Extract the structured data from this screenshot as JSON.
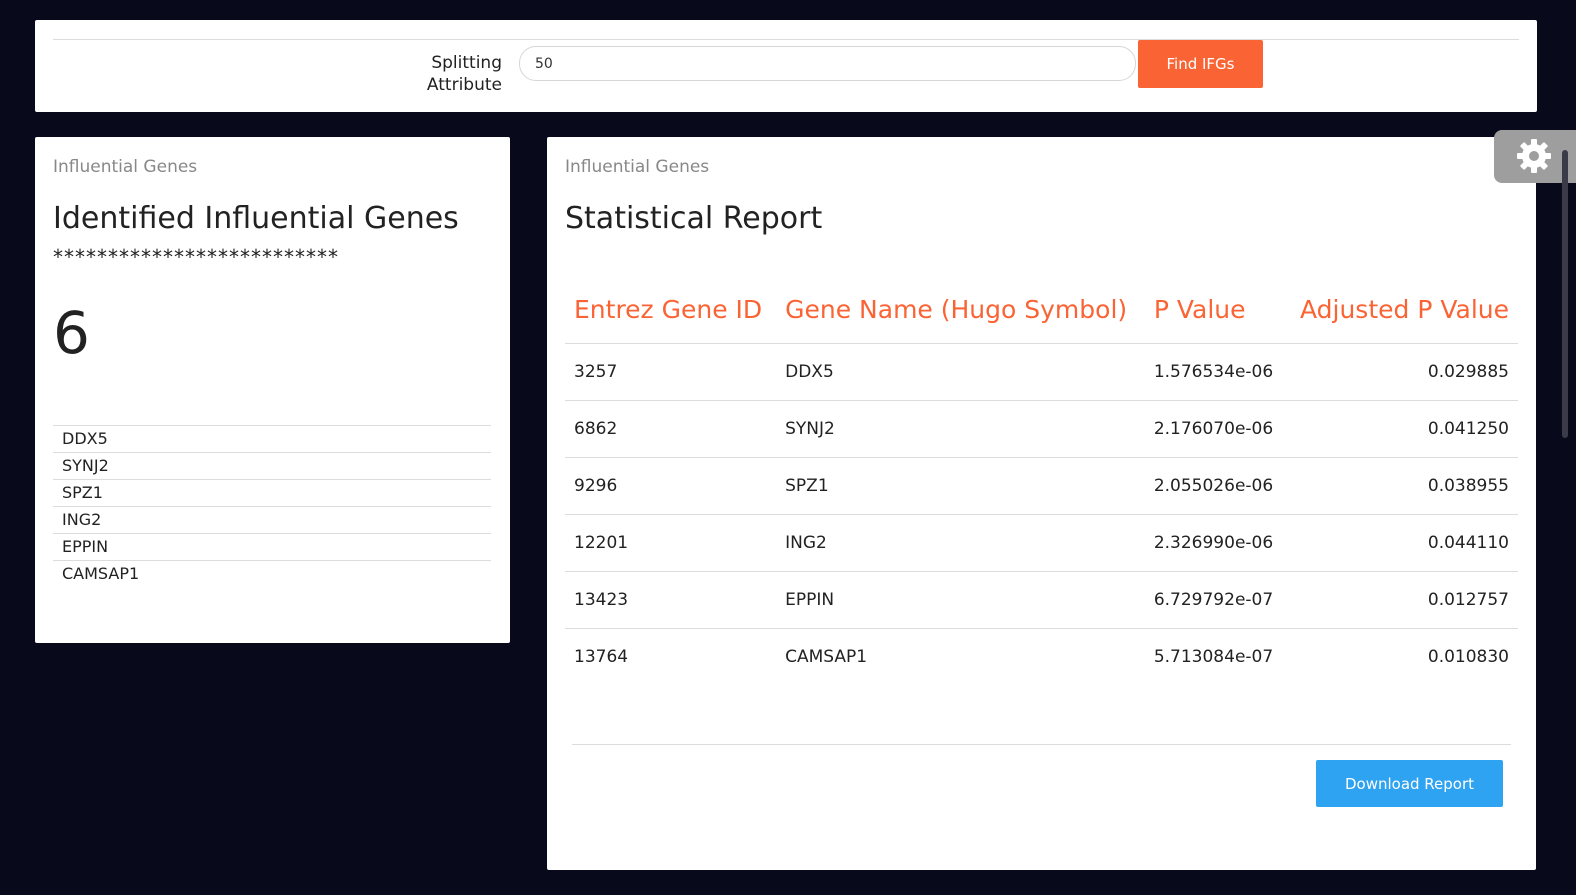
{
  "search": {
    "label": "Splitting Attribute",
    "value": "50",
    "button": "Find IFGs"
  },
  "left_panel": {
    "subtitle": "Influential Genes",
    "title": "Identified Influential Genes",
    "stars": "**************************",
    "count": "6",
    "genes": [
      "DDX5",
      "SYNJ2",
      "SPZ1",
      "ING2",
      "EPPIN",
      "CAMSAP1"
    ]
  },
  "right_panel": {
    "subtitle": "Influential Genes",
    "title": "Statistical Report",
    "columns": [
      "Entrez Gene ID",
      "Gene Name (Hugo Symbol)",
      "P Value",
      "Adjusted P Value"
    ],
    "rows": [
      [
        "3257",
        "DDX5",
        "1.576534e-06",
        "0.029885"
      ],
      [
        "6862",
        "SYNJ2",
        "2.176070e-06",
        "0.041250"
      ],
      [
        "9296",
        "SPZ1",
        "2.055026e-06",
        "0.038955"
      ],
      [
        "12201",
        "ING2",
        "2.326990e-06",
        "0.044110"
      ],
      [
        "13423",
        "EPPIN",
        "6.729792e-07",
        "0.012757"
      ],
      [
        "13764",
        "CAMSAP1",
        "5.713084e-07",
        "0.010830"
      ]
    ],
    "download_button": "Download Report"
  },
  "icons": {
    "settings": "gear-icon"
  },
  "colors": {
    "background": "#080a1b",
    "accent_orange": "#fa6434",
    "accent_blue": "#2ea3f2"
  }
}
